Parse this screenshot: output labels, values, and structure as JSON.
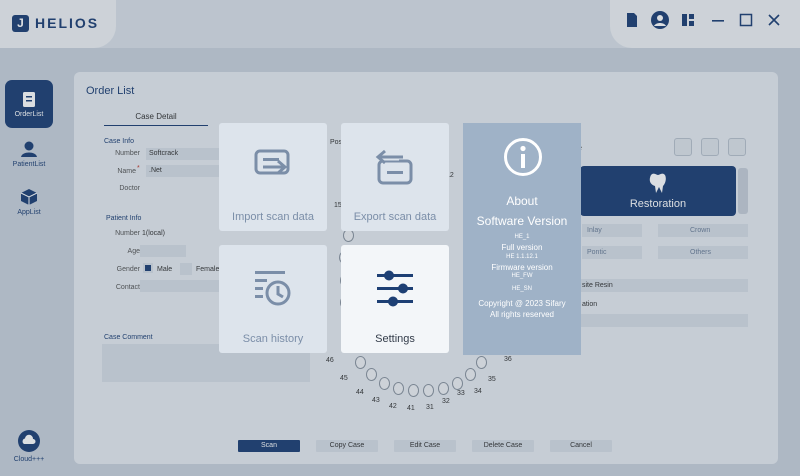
{
  "app": {
    "name": "HELIOS",
    "logo_mark": "J"
  },
  "sidebar": {
    "items": [
      {
        "label": "OrderList",
        "icon": "clipboard-icon"
      },
      {
        "label": "PatientList",
        "icon": "person-icon"
      },
      {
        "label": "AppList",
        "icon": "cube-icon"
      }
    ],
    "cloud_label": "Cloud+++"
  },
  "order": {
    "title": "Order List",
    "tab": "Case Detail",
    "case_info_title": "Case Info",
    "number_label": "Number",
    "number_value": "Softcrack",
    "name_label": "Name",
    "name_required": "*",
    "name_value": ".Net",
    "doctor_label": "Doctor",
    "patient_info_title": "Patient Info",
    "p_number_label": "Number",
    "p_number_value": "1(local)",
    "age_label": "Age",
    "gender_label": "Gender",
    "male_label": "Male",
    "female_label": "Female",
    "contact_label": "Contact",
    "comment_title": "Case Comment",
    "pos_label": "Pos",
    "e_fragment": "e"
  },
  "restoration": {
    "title": "Restoration",
    "options": [
      "Inlay",
      "Crown",
      "Pontic",
      "Others"
    ],
    "material": "site Resin",
    "ation_label": "ation"
  },
  "teeth": {
    "numbers": [
      "46",
      "45",
      "44",
      "43",
      "42",
      "41",
      "31",
      "32",
      "33",
      "34",
      "35",
      "36"
    ],
    "top_numbers": [
      "12",
      "15"
    ]
  },
  "footer_buttons": [
    "Scan",
    "Copy Case",
    "Edit Case",
    "Delete Case",
    "Cancel"
  ],
  "menu": {
    "import": "Import scan data",
    "export": "Export scan data",
    "history": "Scan history",
    "settings": "Settings"
  },
  "about": {
    "title": "About",
    "software_version_label": "Software Version",
    "software_version_value": "HE_1",
    "full_version_label": "Full version",
    "full_version_value": "HE 1.1.12.1",
    "firmware_version_label": "Firmware version",
    "firmware_version_value": "HE_FW",
    "sn_value": "HE_SN",
    "copyright": "Copyright @ 2023 Sifary",
    "rights": "All rights reserved"
  },
  "colors": {
    "brand": "#1d3f74",
    "about_bg": "#9fb2c7",
    "tile_bg": "#dde4ec"
  }
}
